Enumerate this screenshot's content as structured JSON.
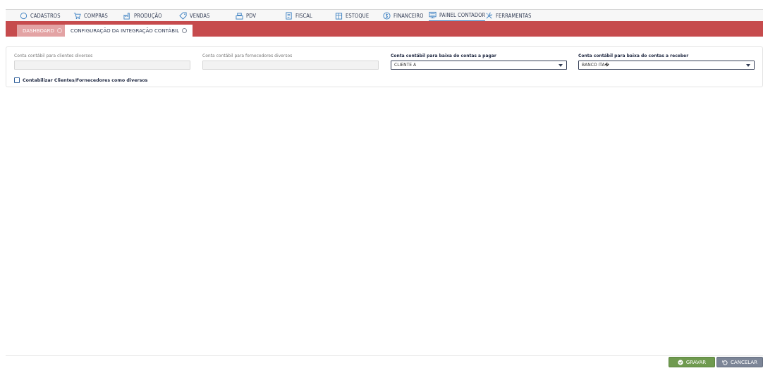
{
  "menu": {
    "items": [
      {
        "label": "CADASTROS",
        "icon": "circle-icon"
      },
      {
        "label": "COMPRAS",
        "icon": "cart-icon"
      },
      {
        "label": "PRODUÇÃO",
        "icon": "factory-icon"
      },
      {
        "label": "VENDAS",
        "icon": "tag-icon"
      },
      {
        "label": "PDV",
        "icon": "register-icon"
      },
      {
        "label": "FISCAL",
        "icon": "document-icon"
      },
      {
        "label": "ESTOQUE",
        "icon": "box-icon"
      },
      {
        "label": "FINANCEIRO",
        "icon": "dollar-icon"
      },
      {
        "label": "PAINEL CONTADOR",
        "icon": "monitor-icon"
      },
      {
        "label": "FERRAMENTAS",
        "icon": "tools-icon"
      }
    ],
    "active": "PAINEL CONTADOR"
  },
  "tabs": [
    {
      "label": "DASHBOARD",
      "active": false
    },
    {
      "label": "CONFIGURAÇÃO DA INTEGRAÇÃO CONTÁBIL",
      "active": true
    }
  ],
  "form": {
    "clientes": {
      "label": "Conta contábil para clientes diversos",
      "value": ""
    },
    "fornecedores": {
      "label": "Conta contábil para fornecedores diversos",
      "value": ""
    },
    "pagar": {
      "label": "Conta contábil para baixa do contas a pagar",
      "value": "CLIENTE A"
    },
    "receber": {
      "label": "Conta contábil para baixa do contas a receber",
      "value": "BANCO ITA�"
    },
    "checkbox_label": "Contabilizar Clientes/Fornecedores como diversos"
  },
  "footer": {
    "save_label": "GRAVAR",
    "cancel_label": "CANCELAR"
  },
  "colors": {
    "tabbar": "#c64b4d",
    "save": "#6f9a4f",
    "cancel": "#7c8597",
    "menu_text": "#333d55"
  }
}
